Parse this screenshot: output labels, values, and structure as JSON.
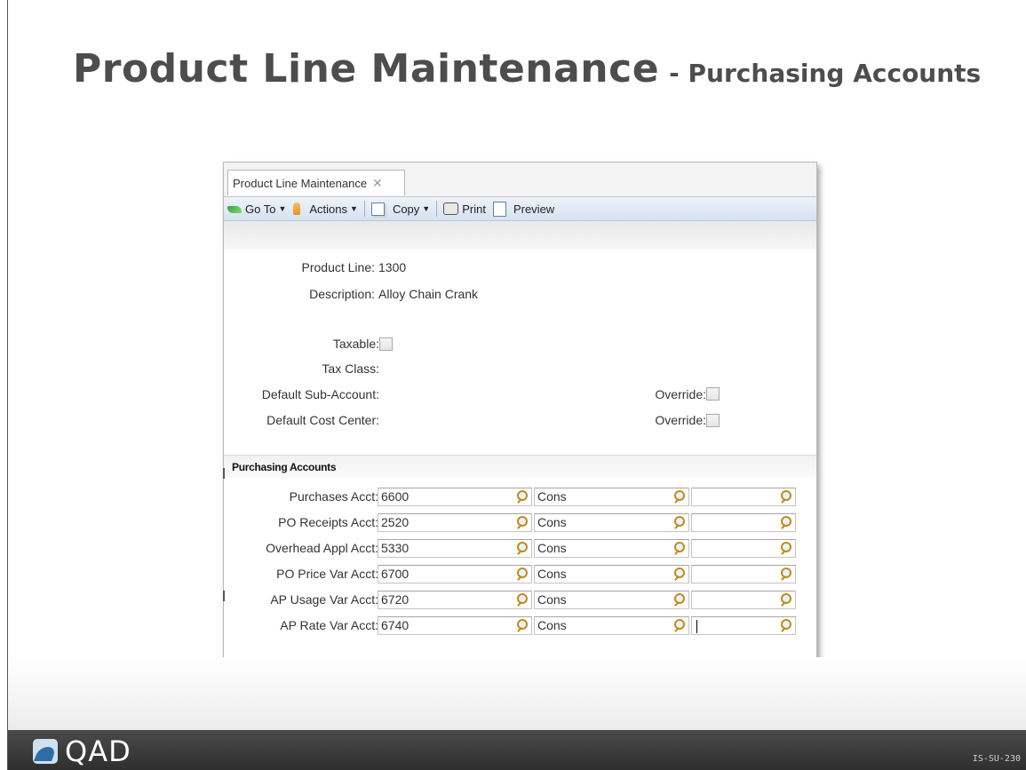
{
  "slide": {
    "title": "Product Line Maintenance",
    "subtitle": "- Purchasing Accounts",
    "footer_code": "IS-SU-230",
    "logo_text": "QAD"
  },
  "window": {
    "tab_label": "Product Line Maintenance",
    "toolbar": {
      "goto_label": "Go To",
      "actions_label": "Actions",
      "copy_label": "Copy",
      "print_label": "Print",
      "preview_label": "Preview"
    }
  },
  "form": {
    "product_line_label": "Product Line:",
    "product_line_value": "1300",
    "description_label": "Description:",
    "description_value": "Alloy Chain Crank",
    "taxable_label": "Taxable:",
    "tax_class_label": "Tax Class:",
    "default_sub_account_label": "Default Sub-Account:",
    "default_cost_center_label": "Default Cost Center:",
    "override_label": "Override:"
  },
  "purchasing": {
    "section_title": "Purchasing Accounts",
    "rows": [
      {
        "label": "Purchases Acct:",
        "account": "6600",
        "sub": "Cons",
        "cc": ""
      },
      {
        "label": "PO Receipts Acct:",
        "account": "2520",
        "sub": "Cons",
        "cc": ""
      },
      {
        "label": "Overhead Appl Acct:",
        "account": "5330",
        "sub": "Cons",
        "cc": ""
      },
      {
        "label": "PO Price Var Acct:",
        "account": "6700",
        "sub": "Cons",
        "cc": ""
      },
      {
        "label": "AP Usage Var Acct:",
        "account": "6720",
        "sub": "Cons",
        "cc": ""
      },
      {
        "label": "AP Rate Var Acct:",
        "account": "6740",
        "sub": "Cons",
        "cc": ""
      }
    ]
  }
}
